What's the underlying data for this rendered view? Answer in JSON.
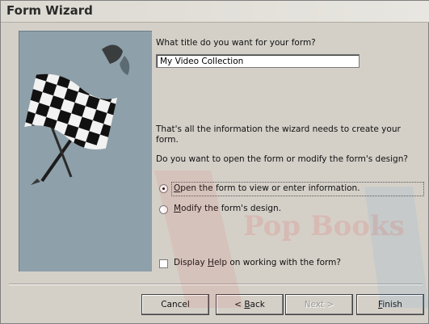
{
  "window": {
    "title": "Form Wizard"
  },
  "form": {
    "title_question": "What title do you want for your form?",
    "title_value": "My Video Collection",
    "info_text": "That's all the information the wizard needs to create your",
    "info_text_2": "form.",
    "open_question": "Do you want to open the form or modify the form's design?"
  },
  "options": {
    "open": {
      "prefix": "",
      "access_key": "O",
      "rest": "pen the form to view or enter information.",
      "checked": true
    },
    "modify": {
      "prefix": "",
      "access_key": "M",
      "rest": "odify the form's design.",
      "checked": false
    },
    "help": {
      "prefix": "Display ",
      "access_key": "H",
      "rest": "elp on working with the form?",
      "checked": false
    }
  },
  "buttons": {
    "cancel": "Cancel",
    "back_prefix": "< ",
    "back_key": "B",
    "back_rest": "ack",
    "next": "Next >",
    "finish_key": "F",
    "finish_rest": "inish"
  },
  "watermark": {
    "text": "Pop Books"
  },
  "colors": {
    "dialog_bg": "#d4d0c8",
    "art_panel_bg": "#8ea0aa",
    "watermark": "#e24a4a"
  },
  "icons": {
    "wizard_art": "checkered-flag-icon"
  }
}
